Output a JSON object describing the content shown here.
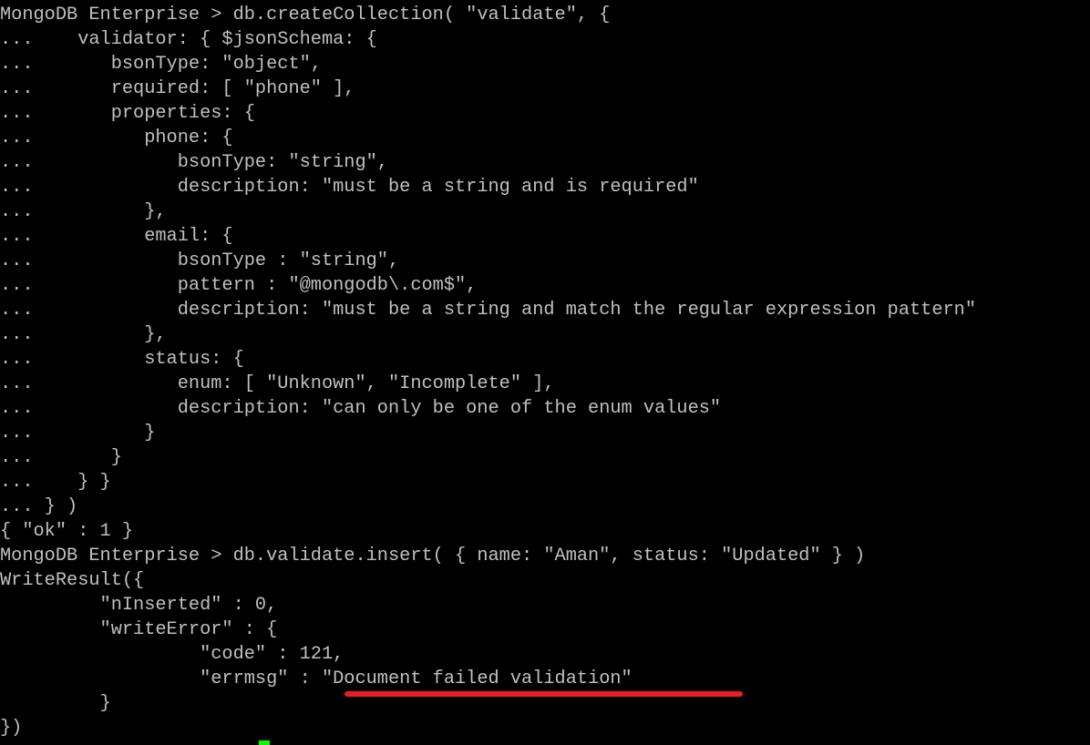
{
  "terminal": {
    "lines": [
      "MongoDB Enterprise > db.createCollection( \"validate\", {",
      "...    validator: { $jsonSchema: {",
      "...       bsonType: \"object\",",
      "...       required: [ \"phone\" ],",
      "...       properties: {",
      "...          phone: {",
      "...             bsonType: \"string\",",
      "...             description: \"must be a string and is required\"",
      "...          },",
      "...          email: {",
      "...             bsonType : \"string\",",
      "...             pattern : \"@mongodb\\.com$\",",
      "...             description: \"must be a string and match the regular expression pattern\"",
      "...          },",
      "...          status: {",
      "...             enum: [ \"Unknown\", \"Incomplete\" ],",
      "...             description: \"can only be one of the enum values\"",
      "...          }",
      "...       }",
      "...    } }",
      "... } )",
      "{ \"ok\" : 1 }",
      "MongoDB Enterprise > db.validate.insert( { name: \"Aman\", status: \"Updated\" } )",
      "WriteResult({",
      "         \"nInserted\" : 0,",
      "         \"writeError\" : {",
      "                  \"code\" : 121,",
      "                  \"errmsg\" : \"Document failed validation\"",
      "         }",
      "})"
    ]
  },
  "colors": {
    "text": "#c0c0c0",
    "background": "#000000",
    "highlight_underline": "#ed1c24",
    "cursor": "#00ff00"
  }
}
